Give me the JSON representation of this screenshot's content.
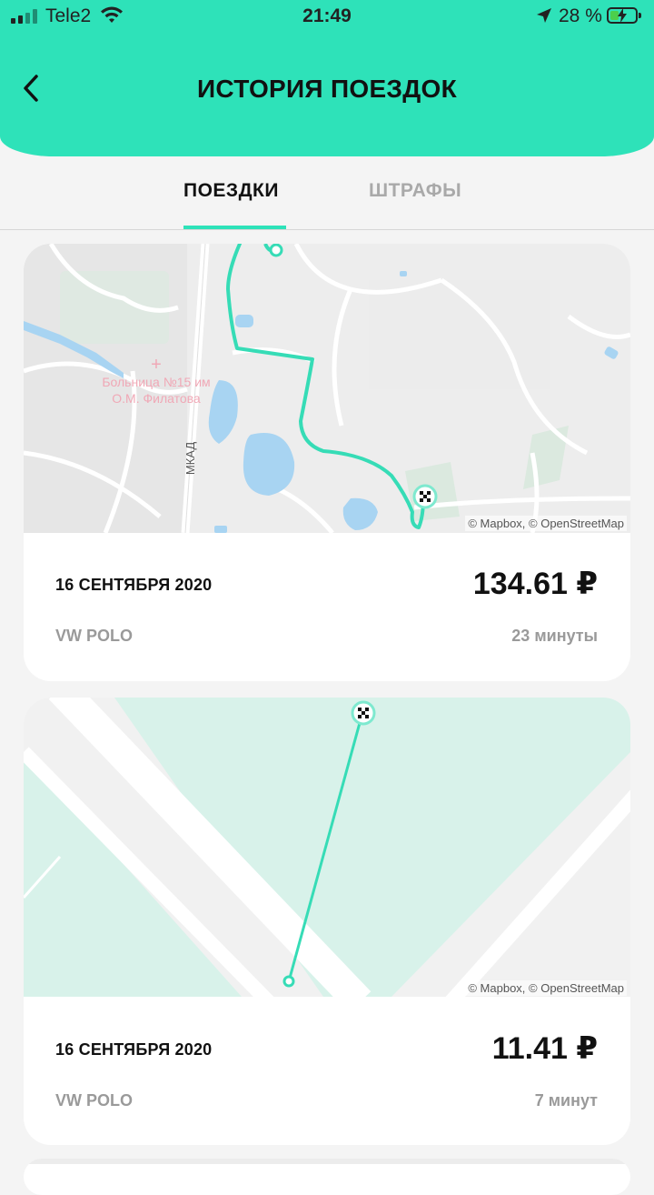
{
  "status_bar": {
    "carrier": "Tele2",
    "time": "21:49",
    "battery": "28 %"
  },
  "header": {
    "title": "ИСТОРИЯ ПОЕЗДОК",
    "back_icon": "chevron-left-icon",
    "background_color": "#2ee2b9"
  },
  "tabs": [
    {
      "label": "ПОЕЗДКИ",
      "active": true
    },
    {
      "label": "ШТРАФЫ",
      "active": false
    }
  ],
  "accent_color": "#2ee2b9",
  "trips": [
    {
      "date": "16 СЕНТЯБРЯ 2020",
      "price": "134.61 ₽",
      "car": "VW POLO",
      "duration": "23 минуты",
      "map_attribution": "© Mapbox, © OpenStreetMap",
      "map_labels": {
        "hospital_line1": "Больница №15 им",
        "hospital_line2": "О.М. Филатова",
        "road": "МКАД"
      }
    },
    {
      "date": "16 СЕНТЯБРЯ 2020",
      "price": "11.41 ₽",
      "car": "VW POLO",
      "duration": "7 минут",
      "map_attribution": "© Mapbox, © OpenStreetMap"
    }
  ]
}
